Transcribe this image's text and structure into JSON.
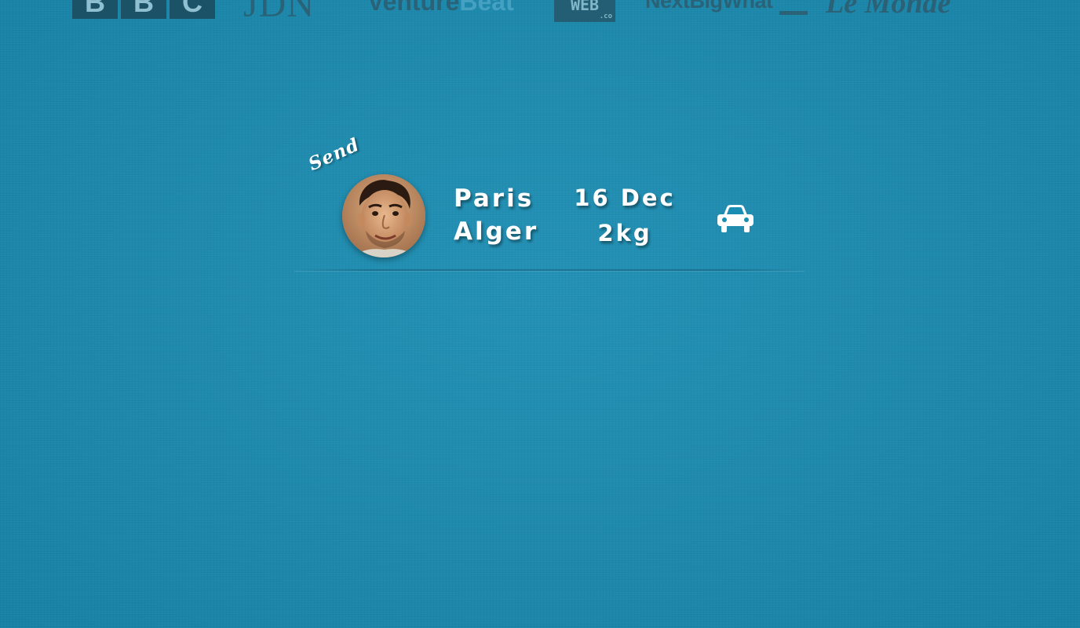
{
  "press_logos": {
    "bbc": [
      "B",
      "B",
      "C"
    ],
    "jdn": "JDN",
    "venturebeat": {
      "part1": "Venture",
      "part2": "Beat"
    },
    "web": {
      "main": "WEB",
      "suffix": ".co"
    },
    "thenextweb": "NextBigWhat",
    "lemonde": "Le Monde"
  },
  "request": {
    "type_label": "Send",
    "from_city": "Paris",
    "to_city": "Alger",
    "date": "16 Dec",
    "weight": "2kg",
    "transport_icon": "car-icon"
  },
  "colors": {
    "background": "#1a8db3",
    "text": "#ffffff",
    "logo": "#2c5e72"
  }
}
